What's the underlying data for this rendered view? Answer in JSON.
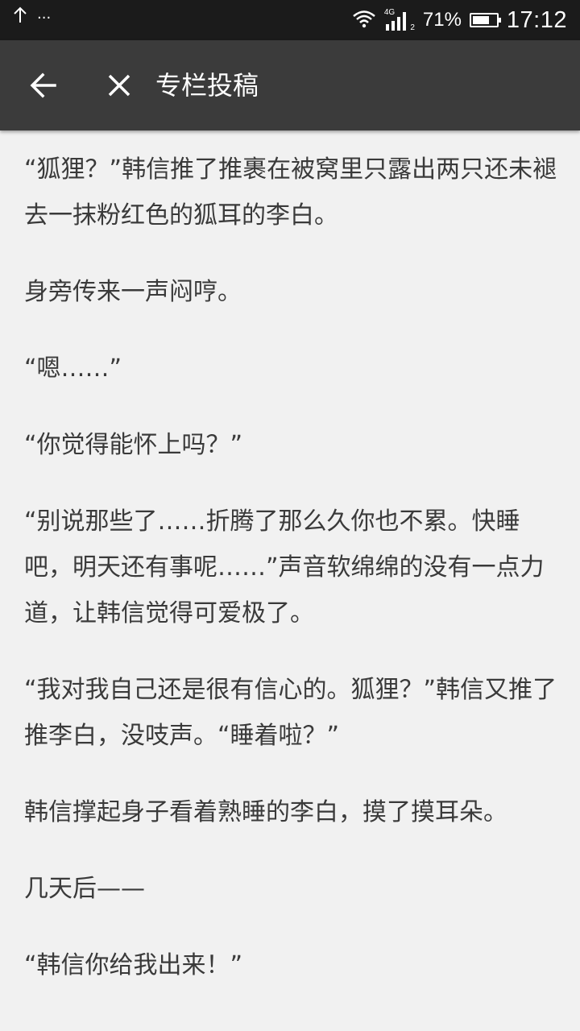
{
  "status_bar": {
    "upload_icon": "arrow-up-icon",
    "more_dots": "···",
    "network": "4G",
    "sim_slot": "2",
    "battery_percent": "71%",
    "battery_level": 0.71,
    "time": "17:12"
  },
  "app_bar": {
    "title": "专栏投稿",
    "back_icon": "arrow-left-icon",
    "close_icon": "close-icon"
  },
  "content": {
    "paragraphs": [
      "“狐狸？”韩信推了推裹在被窝里只露出两只还未褪去一抹粉红色的狐耳的李白。",
      "身旁传来一声闷哼。",
      "“嗯……”",
      "“你觉得能怀上吗？”",
      "“别说那些了……折腾了那么久你也不累。快睡吧，明天还有事呢……”声音软绵绵的没有一点力道，让韩信觉得可爱极了。",
      "“我对我自己还是很有信心的。狐狸？”韩信又推了推李白，没吱声。“睡着啦？”",
      "韩信撑起身子看着熟睡的李白，摸了摸耳朵。",
      "几天后——",
      "“韩信你给我出来！”"
    ]
  },
  "colors": {
    "status_bar_bg": "#1b1b1b",
    "app_bar_bg": "#3b3b3b",
    "page_bg": "#f1f1f1",
    "text": "#3a3a3a"
  }
}
